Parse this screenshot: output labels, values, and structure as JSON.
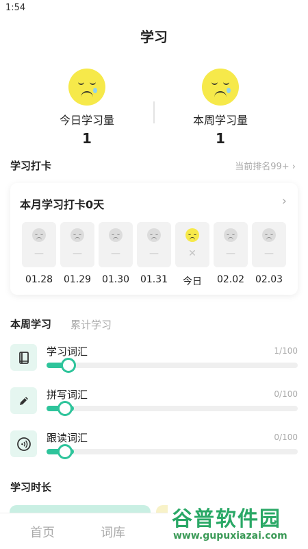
{
  "status_bar": {
    "time": "1:54"
  },
  "page_title": "学习",
  "stats": [
    {
      "label": "今日学习量",
      "value": "1"
    },
    {
      "label": "本周学习量",
      "value": "1"
    }
  ],
  "checkin_section": {
    "title": "学习打卡",
    "rank_text": "当前排名99+ ›"
  },
  "checkin_card": {
    "title": "本月学习打卡0天",
    "arrow": "›",
    "days": [
      {
        "label": "01.28",
        "mark": "—"
      },
      {
        "label": "01.29",
        "mark": "—"
      },
      {
        "label": "01.30",
        "mark": "—"
      },
      {
        "label": "01.31",
        "mark": "—"
      },
      {
        "label": "今日",
        "mark": "✕"
      },
      {
        "label": "02.02",
        "mark": "—"
      },
      {
        "label": "02.03",
        "mark": "—"
      }
    ]
  },
  "study_tabs": {
    "active": "本周学习",
    "inactive": "累计学习"
  },
  "progress": [
    {
      "label": "学习词汇",
      "count": "1/100",
      "icon": "book-icon",
      "value": 0.01
    },
    {
      "label": "拼写词汇",
      "count": "0/100",
      "icon": "pencil-icon",
      "value": 0
    },
    {
      "label": "跟读词汇",
      "count": "0/100",
      "icon": "sound-icon",
      "value": 0
    }
  ],
  "duration_title": "学习时长",
  "bottom_nav": {
    "home": "首页",
    "library": "词库"
  },
  "watermark": {
    "title": "谷普软件园",
    "url": "www.gupuxiazai.com"
  },
  "colors": {
    "accent": "#2ec49b",
    "face": "#f6e94a"
  }
}
